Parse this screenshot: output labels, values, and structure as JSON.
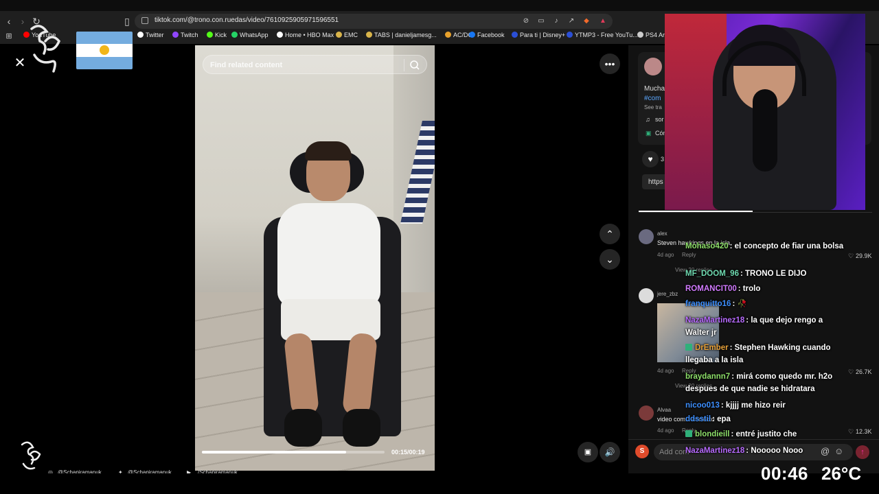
{
  "browser": {
    "url": "tiktok.com/@trono.con.ruedas/video/7610925905971596551",
    "bookmarks": [
      {
        "label": "YouTube",
        "color": "#ff0000"
      },
      {
        "label": "Twitter",
        "color": "#ffffff"
      },
      {
        "label": "Twitch",
        "color": "#9146ff"
      },
      {
        "label": "Kick",
        "color": "#53fc18"
      },
      {
        "label": "WhatsApp",
        "color": "#25d366"
      },
      {
        "label": "Home • HBO Max",
        "color": "#ffffff"
      },
      {
        "label": "EMC",
        "color": "#d9b44a"
      },
      {
        "label": "TABS | danieljamesg...",
        "color": "#d9b44a"
      },
      {
        "label": "AC/DC",
        "color": "#e8a12c"
      },
      {
        "label": "Facebook",
        "color": "#1877f2"
      },
      {
        "label": "Para ti | Disney+",
        "color": "#2b4fd6"
      },
      {
        "label": "YTMP3 - Free YouTu...",
        "color": "#2b4fd6"
      },
      {
        "label": "PS4 Ar...",
        "color": "#cccccc"
      }
    ]
  },
  "page": {
    "search": {
      "placeholder": "Find related content"
    },
    "video": {
      "time": "00:15/00:19",
      "progress": 0.79
    }
  },
  "description": {
    "lines": [
      "Mucha",
      "#com",
      "See tra"
    ],
    "sound": "sor",
    "extra": "Cón",
    "likes": "3",
    "link": "https"
  },
  "comments": [
    {
      "user": "alex",
      "text": "Steven hawkings en la isla",
      "age": "4d ago",
      "reply": "Reply",
      "replies": "View 20 replies",
      "likes": "29.9K"
    },
    {
      "user": "jere_zbz",
      "text": "",
      "age": "4d ago",
      "reply": "Reply",
      "replies": "View 20 replies",
      "likes": "26.7K"
    },
    {
      "user": "Alvaa",
      "text": "video com... correcto",
      "age": "4d ago",
      "reply": "Reply",
      "replies": "",
      "likes": "12.3K"
    }
  ],
  "comment_box": {
    "avatar_letter": "S",
    "placeholder": "Add com"
  },
  "chat": [
    {
      "user": "Mohaso420",
      "color": "#8ee06a",
      "text": ": el concepto de fiar una bolsa",
      "badge": false
    },
    {
      "user": "MF_DOOM_96",
      "color": "#6fd9b0",
      "text": ": TRONO LE DIJO",
      "badge": false
    },
    {
      "user": "ROMANCIT00",
      "color": "#d27bff",
      "text": ": trolo",
      "badge": false
    },
    {
      "user": "franquitto16",
      "color": "#3d8fff",
      "text": ": 🥀",
      "badge": false
    },
    {
      "user": "NazaMartinez18",
      "color": "#b86bff",
      "text": ": la que dejo rengo a Walter jr",
      "badge": false
    },
    {
      "user": "DrEmber",
      "color": "#e8a23a",
      "text": ": Stephen Hawking cuando llegaba a la isla",
      "badge": true
    },
    {
      "user": "braydannn7",
      "color": "#8ee06a",
      "text": ": mirá como quedo mr. h2o despues de que nadie se hidratara",
      "badge": false
    },
    {
      "user": "nicoo013",
      "color": "#3d8fff",
      "text": ": kjjjj me hizo reir",
      "badge": false
    },
    {
      "user": "ddsstil",
      "color": "#3d8fff",
      "text": ": epa",
      "badge": false
    },
    {
      "user": "blondieill",
      "color": "#8ee06a",
      "text": ": entré justito che",
      "badge": true
    },
    {
      "user": "NazaMartinez18",
      "color": "#b86bff",
      "text": ": Nooooo Nooo",
      "badge": false
    }
  ],
  "overlay": {
    "socials": [
      "@Schapiramanuk",
      "@Schapiramanuk",
      "/Schapiramanuk"
    ],
    "clock": "00:46",
    "temp": "26°C"
  }
}
